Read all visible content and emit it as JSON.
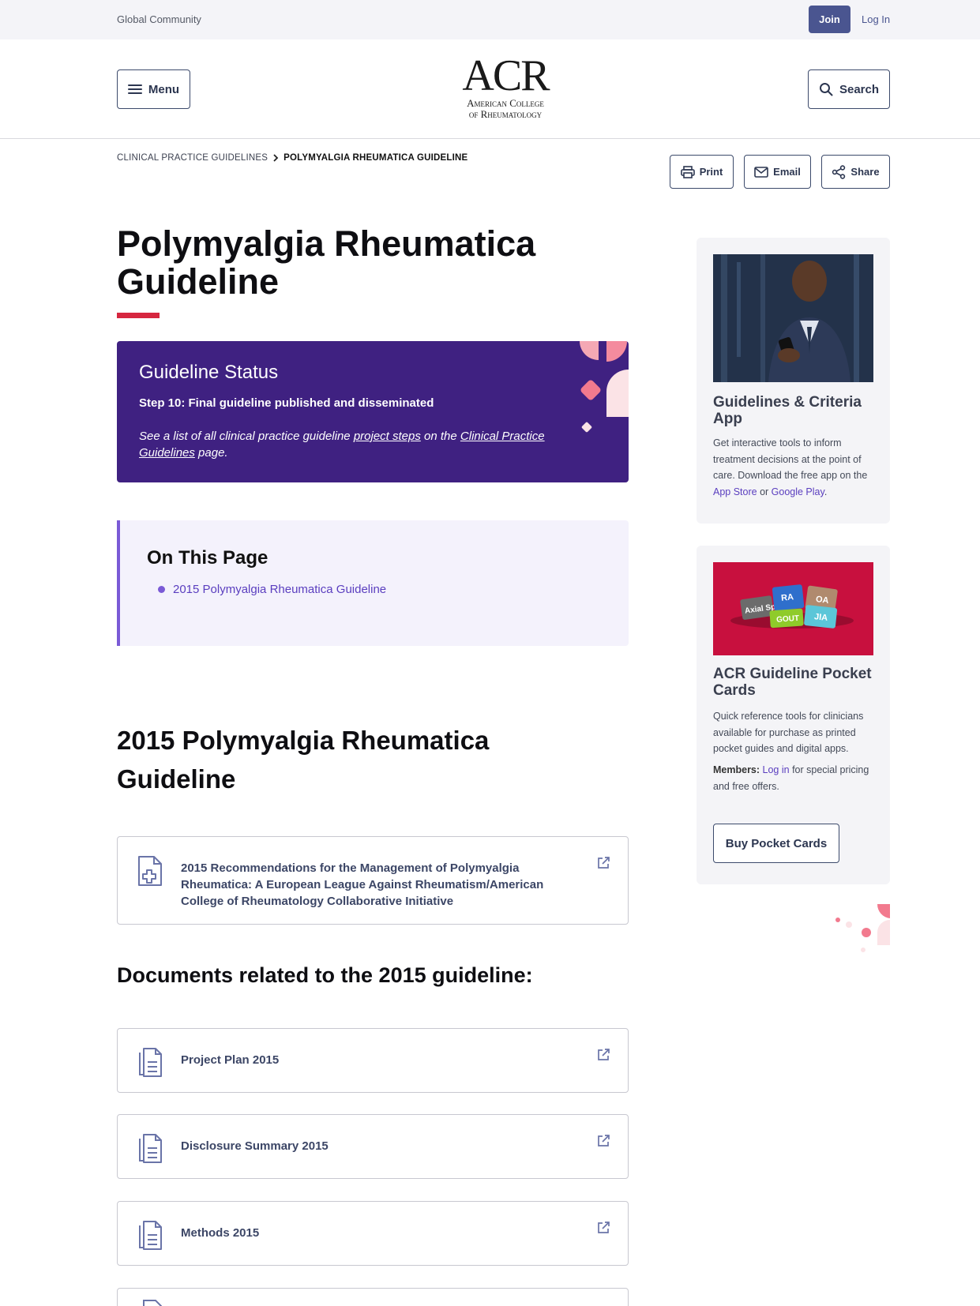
{
  "utility": {
    "community": "Global Community",
    "join": "Join",
    "login": "Log In"
  },
  "header": {
    "menu": "Menu",
    "search": "Search",
    "logo_big": "ACR",
    "logo_line1": "American College",
    "logo_line2": "of Rheumatology"
  },
  "breadcrumb": {
    "parent": "CLINICAL PRACTICE GUIDELINES",
    "current": "POLYMYALGIA RHEUMATICA GUIDELINE"
  },
  "tools": {
    "print": "Print",
    "email": "Email",
    "share": "Share"
  },
  "page_title": "Polymyalgia Rheumatica Guideline",
  "status": {
    "heading": "Guideline Status",
    "step": "Step 10: Final guideline published and disseminated",
    "note_prefix": "See a list of all clinical practice guideline ",
    "note_link1": "project steps",
    "note_mid": " on the ",
    "note_link2": "Clinical Practice Guidelines",
    "note_suffix": " page."
  },
  "on_this_page": {
    "heading": "On This Page",
    "items": [
      "2015 Polymyalgia Rheumatica Guideline"
    ]
  },
  "section_title": "2015 Polymyalgia Rheumatica Guideline",
  "main_doc": "2015 Recommendations for the Management of Polymyalgia Rheumatica: A European League Against Rheumatism/American College of Rheumatology Collaborative Initiative",
  "related_heading": "Documents related to the 2015 guideline:",
  "related_docs": [
    "Project Plan 2015",
    "Disclosure Summary 2015",
    "Methods 2015"
  ],
  "sidebar": {
    "app": {
      "title": "Guidelines & Criteria App",
      "text": "Get interactive tools to inform treatment decisions at the point of care. Download the free app on the ",
      "link1": "App Store",
      "or": " or ",
      "link2": "Google Play",
      "end": "."
    },
    "cards": {
      "title": "ACR Guideline Pocket Cards",
      "text": "Quick reference tools for clinicians available for purchase as printed pocket guides and digital apps.",
      "members_label": "Members:",
      "members_link": "Log in",
      "members_text": " for special pricing and free offers.",
      "button": "Buy Pocket Cards",
      "tiles": [
        "Axial SpA",
        "RA",
        "OA",
        "GOUT",
        "JIA"
      ]
    }
  },
  "colors": {
    "accent": "#3f2181",
    "red": "#d6263f",
    "link": "#5a3ebf",
    "navy": "#4a5590"
  }
}
